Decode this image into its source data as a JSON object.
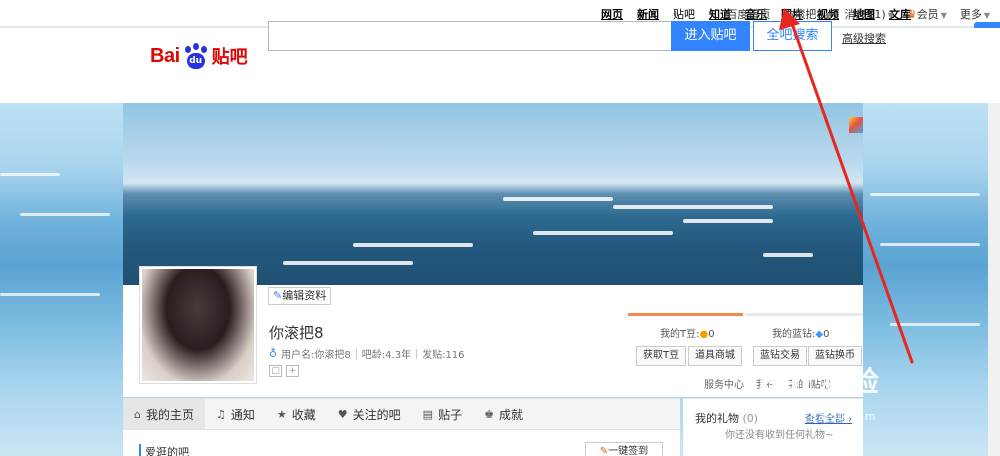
{
  "top_nav": {
    "links": [
      "网页",
      "新闻",
      "贴吧",
      "知道",
      "音乐",
      "图片",
      "视频",
      "地图",
      "文库"
    ],
    "right": {
      "home": "百度首页",
      "user": "你滚把8",
      "messages": "消息 (1)",
      "vip": "会员",
      "more": "更多"
    }
  },
  "header": {
    "logo_bai": "Bai",
    "logo_du": "du",
    "logo_tieba": "贴吧",
    "search_value": "",
    "enter_button": "进入贴吧",
    "all_search_button": "全吧搜索",
    "advanced_search": "高级搜索"
  },
  "profile": {
    "edit_button": "编辑资料",
    "username": "你滚把8",
    "user_id": "用户名:你滚把8",
    "age": "吧龄:4.3年",
    "posts": "发贴:116",
    "tbean_label": "我的T豆:",
    "tbean_value": "0",
    "tbean_btn_get": "获取T豆",
    "tbean_btn_shop": "道具商城",
    "diamond_label": "我的蓝钻:",
    "diamond_value": "0",
    "diamond_btn_trade": "蓝钻交易",
    "diamond_btn_exchange": "蓝钻换币",
    "services": [
      "服务中心",
      "我在",
      "我的i贴吧"
    ]
  },
  "tabs": [
    {
      "icon": "home-icon",
      "label": "我的主页",
      "active": true
    },
    {
      "icon": "bell-icon",
      "label": "通知",
      "active": false
    },
    {
      "icon": "star-icon",
      "label": "收藏",
      "active": false
    },
    {
      "icon": "heart-icon",
      "label": "关注的吧",
      "active": false
    },
    {
      "icon": "document-icon",
      "label": "贴子",
      "active": false
    },
    {
      "icon": "trophy-icon",
      "label": "成就",
      "active": false
    }
  ],
  "content": {
    "section_title": "爱逛的吧",
    "sign_button": "一键签到"
  },
  "gift": {
    "label": "我的礼物",
    "count": "(0)",
    "view_all": "查看全部 ›",
    "empty_text": "你还没有收到任何礼物~"
  },
  "watermark": {
    "text": "Bai 经验",
    "url": "jingyan.baidu.com"
  },
  "colors": {
    "accent": "#3385ff",
    "logo_red": "#e10602",
    "logo_blue": "#2932e1",
    "annotation_red": "#e8261f",
    "tbean_orange": "#f08a52"
  }
}
